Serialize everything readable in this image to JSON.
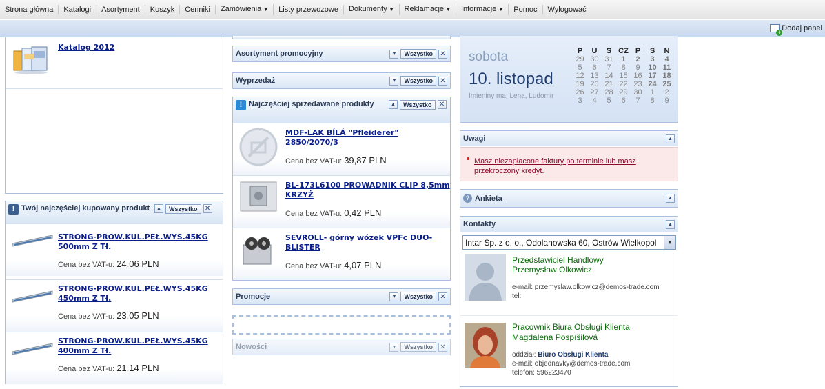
{
  "menu": {
    "items": [
      {
        "label": "Strona główna",
        "dropdown": false
      },
      {
        "label": "Katalogi",
        "dropdown": false
      },
      {
        "label": "Asortyment",
        "dropdown": false
      },
      {
        "label": "Koszyk",
        "dropdown": false
      },
      {
        "label": "Cenniki",
        "dropdown": false
      },
      {
        "label": "Zamówienia",
        "dropdown": true
      },
      {
        "label": "Listy przewozowe",
        "dropdown": false
      },
      {
        "label": "Dokumenty",
        "dropdown": true
      },
      {
        "label": "Reklamacje",
        "dropdown": true
      },
      {
        "label": "Informacje",
        "dropdown": true
      },
      {
        "label": "Pomoc",
        "dropdown": false
      },
      {
        "label": "Wylogować",
        "dropdown": false
      }
    ]
  },
  "panelbar": {
    "add_panel_label": "Dodaj panel"
  },
  "catalog": {
    "link": "Katalog 2012"
  },
  "common": {
    "all_label": "Wszystko",
    "price_label": "Cena bez VAT-u:",
    "collapse_icon": "chevron-down-icon",
    "close_icon": "close-icon",
    "expand_icon": "chevron-up-icon",
    "warn_icon": "!"
  },
  "mostbought": {
    "title": "Twój najczęściej kupowany produkt",
    "products": [
      {
        "name": "STRONG-PROW.KUL.PEŁ.WYS.45KG 500mm Z Tł.",
        "price": "24,06 PLN"
      },
      {
        "name": "STRONG-PROW.KUL.PEŁ.WYS.45KG 450mm Z Tł.",
        "price": "23,05 PLN"
      },
      {
        "name": "STRONG-PROW.KUL.PEŁ.WYS.45KG 400mm Z Tł.",
        "price": "21,14 PLN"
      }
    ]
  },
  "promo_assort": {
    "title": "Asortyment promocyjny"
  },
  "sale": {
    "title": "Wyprzedaż"
  },
  "bestsellers": {
    "title": "Najczęściej sprzedawane produkty",
    "products": [
      {
        "name": "MDF-LAK BÍLÁ \"Pfleiderer\" 2850/2070/3",
        "price": "39,87 PLN"
      },
      {
        "name": "BL-173L6100 PROWADNIK CLIP 8,5mm KRZYŻ",
        "price": "0,42 PLN"
      },
      {
        "name": "SEVROLL- górny wózek VPFc DUO-BLISTER",
        "price": "4,07 PLN"
      }
    ]
  },
  "promotions": {
    "title": "Promocje"
  },
  "news": {
    "title": "Nowości"
  },
  "calendar": {
    "weekday": "sobota",
    "date": "10. listopad",
    "nameday": "Imieniny ma: Lena, Ludomir",
    "headers": [
      "P",
      "U",
      "S",
      "CZ",
      "P",
      "S",
      "N"
    ],
    "weeks": [
      [
        "29",
        "30",
        "31",
        "1",
        "2",
        "3",
        "4"
      ],
      [
        "5",
        "6",
        "7",
        "8",
        "9",
        "10",
        "11"
      ],
      [
        "12",
        "13",
        "14",
        "15",
        "16",
        "17",
        "18"
      ],
      [
        "19",
        "20",
        "21",
        "22",
        "23",
        "24",
        "25"
      ],
      [
        "26",
        "27",
        "28",
        "29",
        "30",
        "1",
        "2"
      ],
      [
        "3",
        "4",
        "5",
        "6",
        "7",
        "8",
        "9"
      ]
    ]
  },
  "notes": {
    "title": "Uwagi",
    "message": "Masz niezapłacone faktury po terminie lub masz przekroczony kredyt."
  },
  "survey": {
    "title": "Ankieta"
  },
  "contacts": {
    "title": "Kontakty",
    "select_value": "Intar Sp. z o. o., Odolanowska 60, Ostrów Wielkopol",
    "rep": {
      "role": "Przedstawiciel Handlowy",
      "name": "Przemysław Olkowicz",
      "email": "e-mail: przemyslaw.olkowicz@demos-trade.com",
      "tel": "tel:"
    },
    "office": {
      "role": "Pracownik Biura Obsługi Klienta",
      "name": "Magdalena Pospíšilová",
      "dept_label": "oddział:",
      "dept": "Biuro Obsługi Klienta",
      "email": "e-mail: objednavky@demos-trade.com",
      "tel": "telefon: 596223470"
    }
  },
  "colors": {
    "panel_border": "#a8c0e0",
    "link": "#0b1f8a",
    "contact_green": "#0a6a0a",
    "calendar_date": "#1f3d6e",
    "alert_bg": "#fbe9ea",
    "alert_text": "#8a0a2a"
  }
}
